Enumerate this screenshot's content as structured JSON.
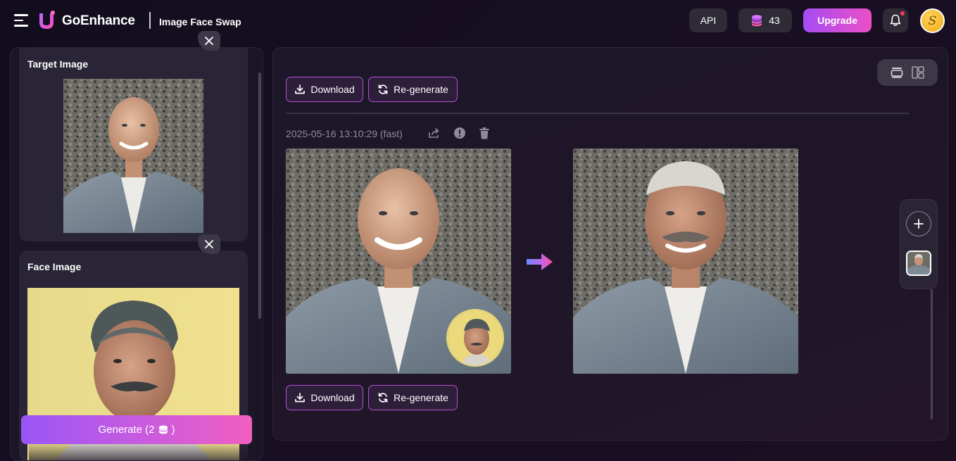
{
  "header": {
    "brand": "GoEnhance",
    "page_title": "Image Face Swap",
    "api_label": "API",
    "credits": "43",
    "upgrade_label": "Upgrade",
    "avatar_letter": "S"
  },
  "left_panel": {
    "target_title": "Target Image",
    "face_title": "Face Image",
    "generate_label": "Generate (2",
    "generate_suffix": ")"
  },
  "main": {
    "download_label": "Download",
    "regenerate_label": "Re-generate",
    "timestamp": "2025-05-16 13:10:29 (fast)"
  },
  "icons": {
    "menu": "menu-icon",
    "logo": "goenhance-logo",
    "credits": "coin-stack-icon",
    "bell": "bell-icon",
    "close": "close-icon",
    "download": "download-icon",
    "regenerate": "refresh-icon",
    "share": "share-icon",
    "info": "info-icon",
    "trash": "trash-icon",
    "arrow": "arrow-right-icon",
    "add": "plus-icon",
    "view_single": "single-view-icon",
    "view_grid": "grid-view-icon"
  },
  "colors": {
    "accent_gradient_start": "#a64bf4",
    "accent_gradient_end": "#ec4fc4",
    "button_border": "#b64fd6",
    "background": "#130e1c"
  }
}
